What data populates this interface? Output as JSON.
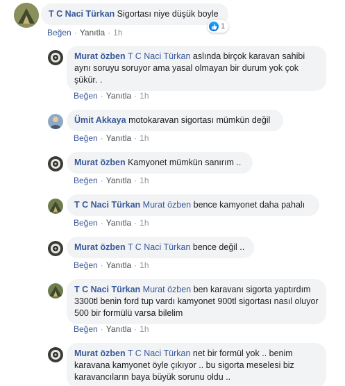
{
  "actions": {
    "like": "Beğen",
    "reply": "Yanıtla",
    "separator": "·"
  },
  "comments": [
    {
      "author": "T C Naci Türkan",
      "text": "Sigortası niye düşük boyle",
      "time": "1h",
      "reactions": {
        "type": "like",
        "count": "1"
      }
    },
    {
      "author": "Murat özben",
      "mention": "T C Naci Türkan",
      "text": "aslında birçok karavan sahibi aynı soruyu soruyor ama yasal olmayan bir durum yok çok şükür. .",
      "time": "1h"
    },
    {
      "author": "Ümit Akkaya",
      "text": "motokaravan sigortası mümkün değil",
      "time": "1h"
    },
    {
      "author": "Murat özben",
      "text": "Kamyonet mümkün sanırım ..",
      "time": "1h"
    },
    {
      "author": "T C Naci Türkan",
      "mention": "Murat özben",
      "text": "bence kamyonet daha pahalı",
      "time": "1h"
    },
    {
      "author": "Murat özben",
      "mention": "T C Naci Türkan",
      "text": "bence değil ..",
      "time": "1h"
    },
    {
      "author": "T C Naci Türkan",
      "mention": "Murat özben",
      "text": "ben karavanı sigorta yaptırdım 3300tl benin ford tup vardı kamyonet 900tl sigortası nasıl oluyor 500 bir formülü varsa bilelim",
      "time": "1h"
    },
    {
      "author": "Murat özben",
      "mention": "T C Naci Türkan",
      "text": "net bir formül yok .. benim karavana kamyonet öyle çıkıyor .. bu sigorta meselesi biz karavancıların baya büyük sorunu oldu ..",
      "time": "1h"
    }
  ],
  "colors": {
    "link": "#385898",
    "bubble": "#f2f3f5",
    "meta": "#90949c",
    "like_blue": "#1877f2"
  }
}
